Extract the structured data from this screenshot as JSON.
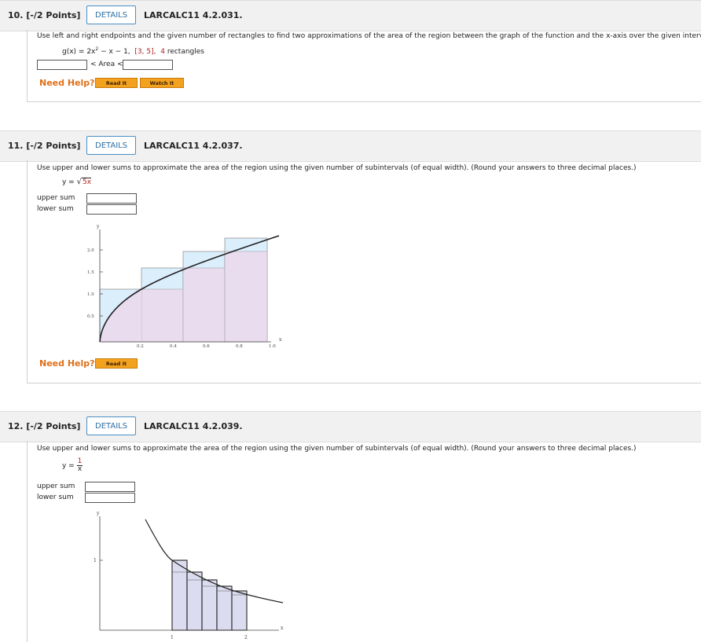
{
  "q10": {
    "number": "10. [-/2 Points]",
    "details": "DETAILS",
    "code": "LARCALC11 4.2.031.",
    "prompt": "Use left and right endpoints and the given number of rectangles to find two approximations of the area of the region between the graph of the function and the x-axis over the given interval.",
    "func_lhs": "g(x) = 2x",
    "func_exp": "2",
    "func_rest": " − x − 1,",
    "interval": "[3, 5],",
    "rect_count": "4",
    "rect_word": "rectangles",
    "area_label": "< Area <",
    "need_help": "Need Help?",
    "read_it": "Read It",
    "watch_it": "Watch It"
  },
  "q11": {
    "number": "11. [-/2 Points]",
    "details": "DETAILS",
    "code": "LARCALC11 4.2.037.",
    "prompt": "Use upper and lower sums to approximate the area of the region using the given number of subintervals (of equal width). (Round your answers to three decimal places.)",
    "func_lhs": "y =",
    "func_radicand": "5x",
    "upper_label": "upper sum",
    "lower_label": "lower sum",
    "need_help": "Need Help?",
    "read_it": "Read It",
    "graph": {
      "y_axis_label": "y",
      "x_axis_label": "x",
      "y_ticks": [
        "2.0",
        "1.5",
        "1.0",
        "0.5"
      ],
      "x_ticks": [
        "0.2",
        "0.4",
        "0.6",
        "0.8",
        "1.0"
      ]
    }
  },
  "q12": {
    "number": "12. [-/2 Points]",
    "details": "DETAILS",
    "code": "LARCALC11 4.2.039.",
    "prompt": "Use upper and lower sums to approximate the area of the region using the given number of subintervals (of equal width). (Round your answers to three decimal places.)",
    "func_lhs": "y =",
    "func_num": "1",
    "func_den": "x",
    "upper_label": "upper sum",
    "lower_label": "lower sum",
    "graph": {
      "y_axis_label": "y",
      "x_axis_label": "x",
      "y_ticks": [
        "1"
      ],
      "x_ticks": [
        "1",
        "2"
      ]
    }
  },
  "colors": {
    "accent": "#2d6ea3",
    "help_orange": "#e0701a",
    "button_orange": "#f3a21f",
    "upper_fill": "#dbeefc",
    "lower_fill": "#e9dcef"
  }
}
